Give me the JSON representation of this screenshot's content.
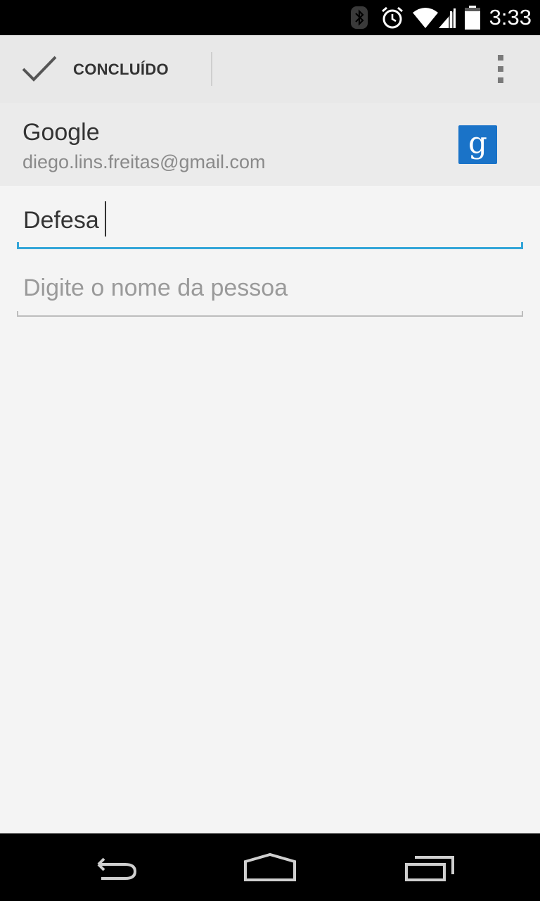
{
  "status_bar": {
    "time": "3:33",
    "icons": [
      "bluetooth-icon",
      "alarm-icon",
      "wifi-icon",
      "signal-icon",
      "battery-icon"
    ]
  },
  "action_bar": {
    "done_label": "CONCLUÍDO",
    "done_icon": "check-icon",
    "overflow_icon": "overflow-menu-icon"
  },
  "account": {
    "type": "Google",
    "email": "diego.lins.freitas@gmail.com",
    "icon": "google-icon",
    "icon_glyph": "g"
  },
  "form": {
    "group_name_value": "Defesa",
    "person_placeholder": "Digite o nome da pessoa"
  },
  "nav_bar": {
    "buttons": [
      "back-icon",
      "home-icon",
      "recents-icon"
    ]
  },
  "colors": {
    "accent": "#33a5d8",
    "background": "#f4f4f4",
    "action_bar": "#e8e8e8",
    "google_icon": "#1a73c8"
  }
}
